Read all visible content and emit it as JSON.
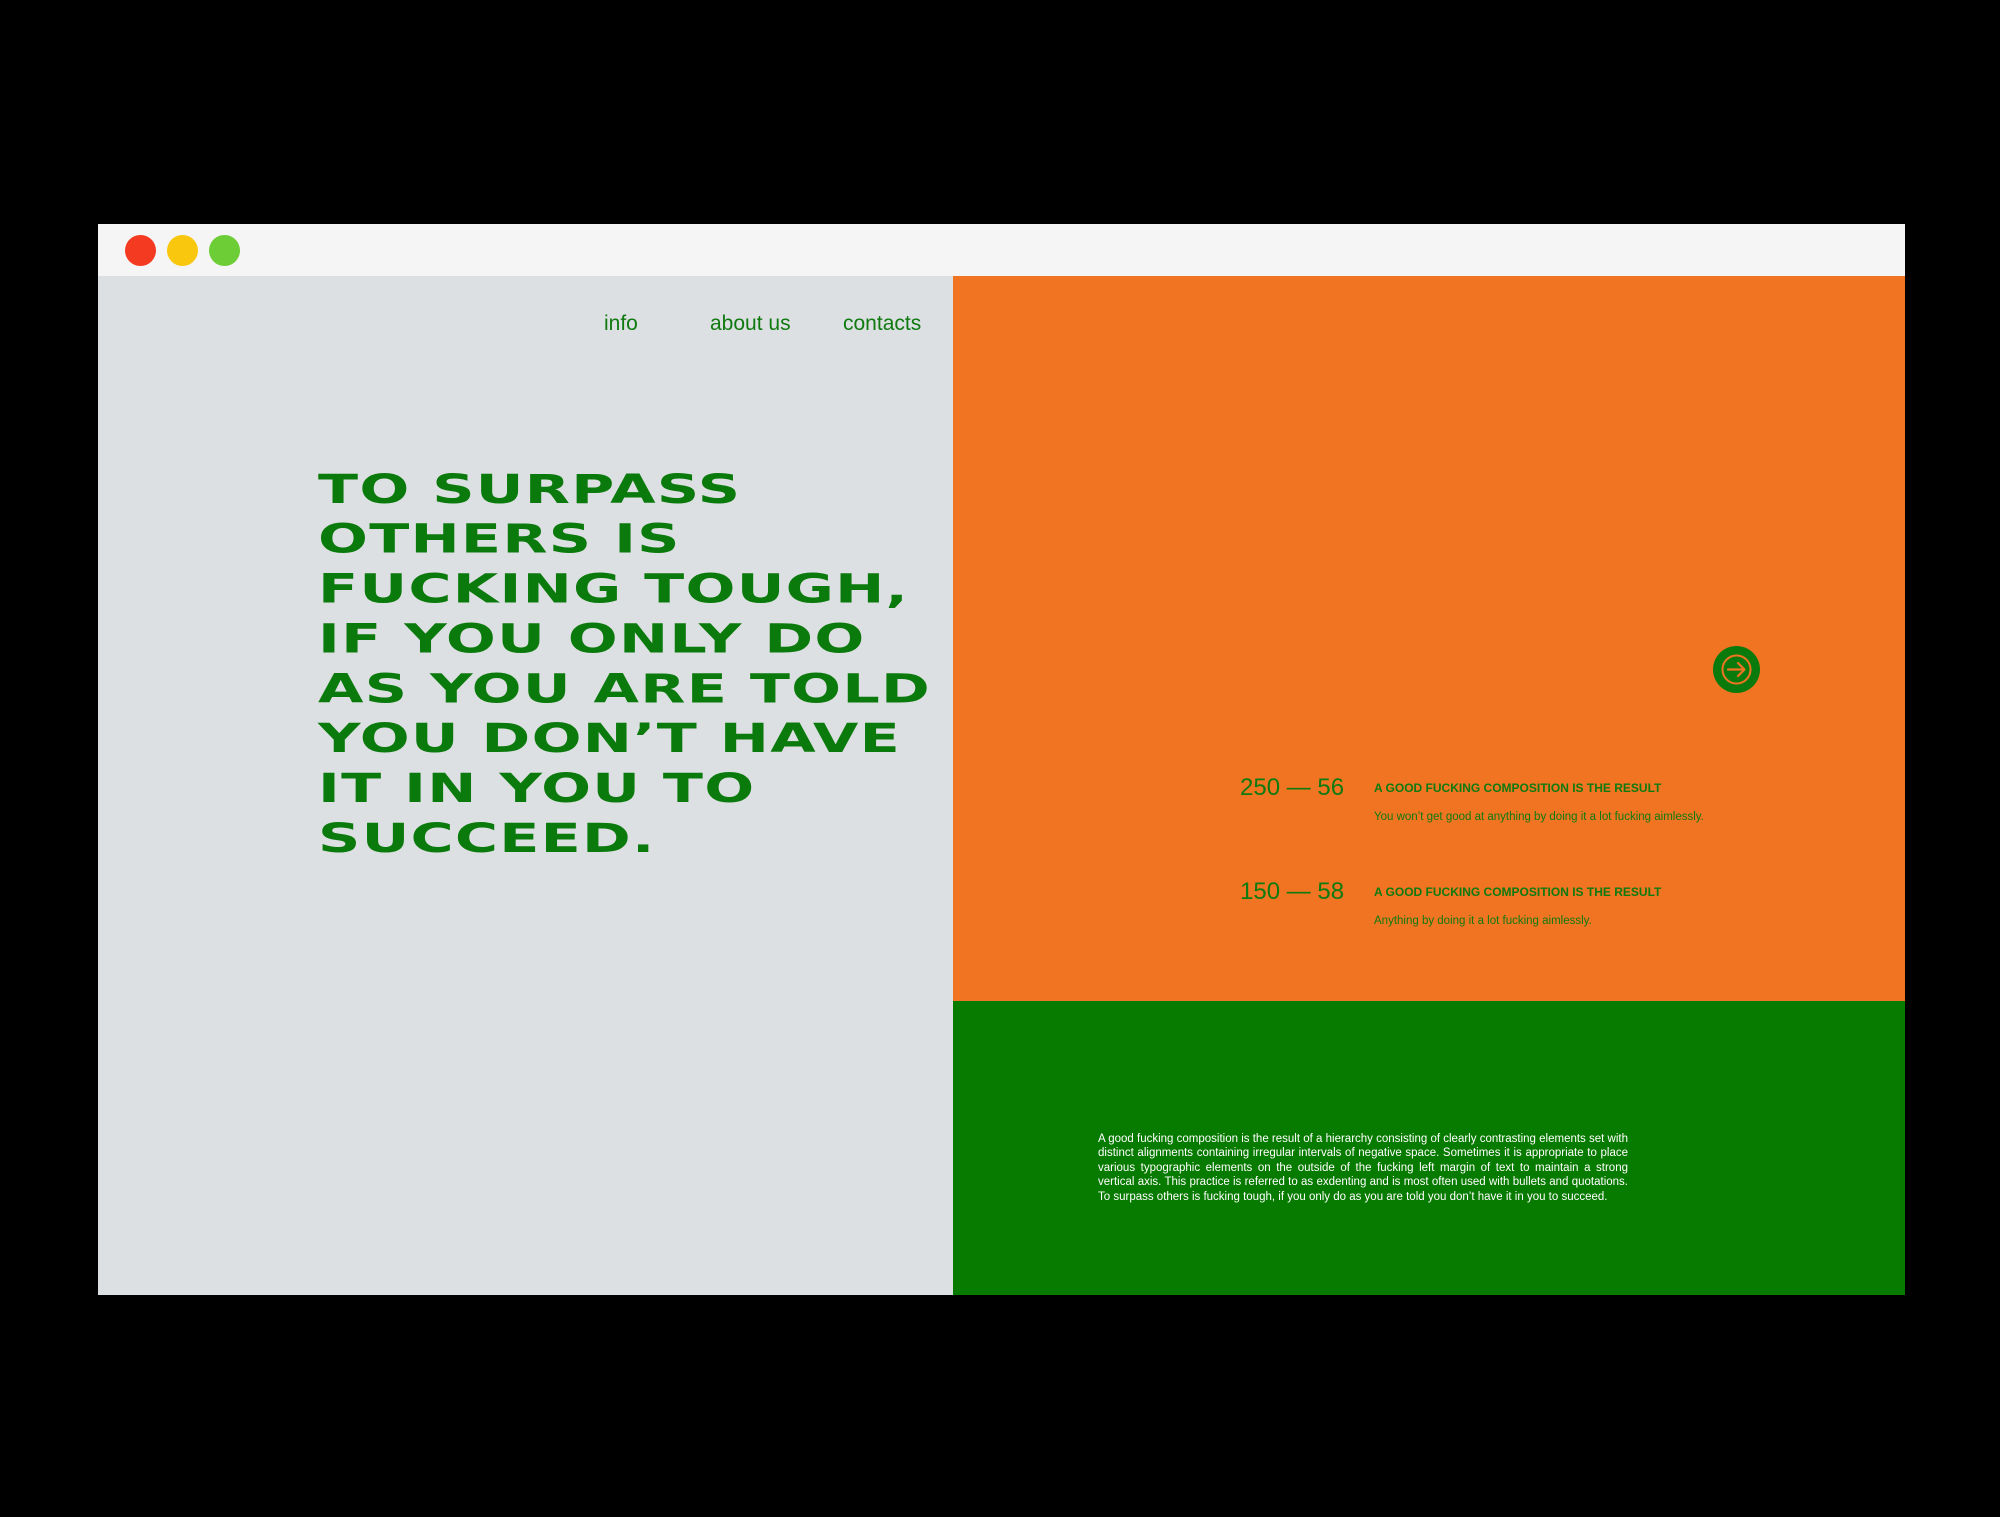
{
  "window": {
    "controls": [
      "close",
      "minimize",
      "maximize"
    ],
    "colors": {
      "close": "#f53a22",
      "minimize": "#f9c80e",
      "maximize": "#6ccd36"
    }
  },
  "nav": {
    "items": [
      {
        "label": "info"
      },
      {
        "label": "about us"
      },
      {
        "label": "contacts"
      }
    ]
  },
  "hero": {
    "headline": "TO SURPASS\nOTHERS IS\nFUCKING TOUGH,\nIF YOU ONLY DO\nAS YOU ARE TOLD\nYOU DON’T HAVE\nIT IN YOU TO\nSUCCEED."
  },
  "stats": [
    {
      "number": "250 — 56",
      "title": "A GOOD FUCKING COMPOSITION IS THE RESULT",
      "description": "You won’t get good at anything by doing it a lot fucking aimlessly."
    },
    {
      "number": "150 — 58",
      "title": "A GOOD FUCKING COMPOSITION IS THE RESULT",
      "description": "Anything by doing it a lot fucking aimlessly."
    }
  ],
  "next_button": {
    "icon": "arrow-right-icon"
  },
  "body": {
    "paragraph": "A good fucking composition is the result of a hierarchy consisting of clearly contrasting elements set with distinct alignments containing irregular intervals of negative space. Sometimes it is appropriate to place various typographic elements on the outside of the fucking left margin of text to maintain a strong vertical axis. This practice is referred to as exdenting and is most often used with bullets and quotations. To surpass others is fucking tough, if you only do as you are told you don’t have it in you to succeed."
  },
  "colors": {
    "background": "#000000",
    "left_panel": "#dde0e2",
    "orange_panel": "#f17422",
    "green_panel": "#077a00",
    "accent_green": "#0b7a0c"
  }
}
